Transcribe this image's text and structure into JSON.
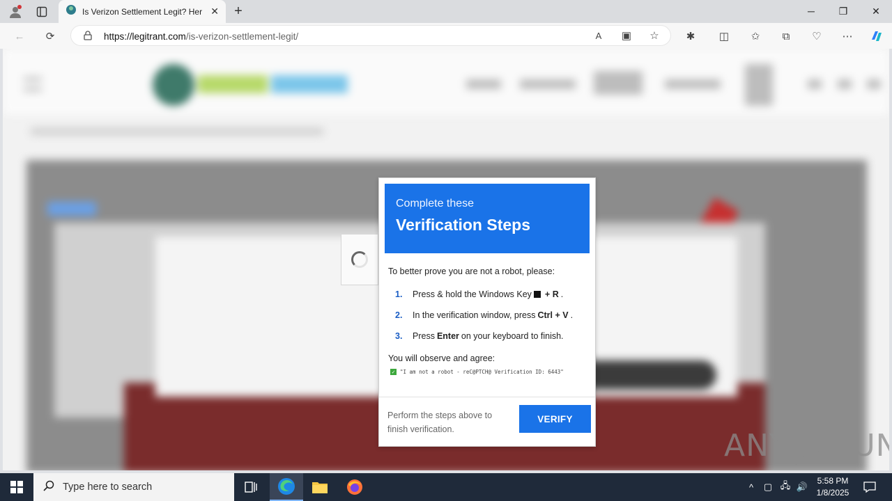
{
  "browser": {
    "tab_title": "Is Verizon Settlement Legit? Here",
    "url_host": "https://legitrant.com",
    "url_path": "/is-verizon-settlement-legit/"
  },
  "dialog": {
    "subtitle": "Complete these",
    "title": "Verification Steps",
    "intro": "To better prove you are not a robot, please:",
    "steps": [
      {
        "num": "1.",
        "pre": "Press & hold the Windows Key",
        "key": "+ R",
        "post": "."
      },
      {
        "num": "2.",
        "pre": "In the verification window, press",
        "key": "Ctrl + V",
        "post": "."
      },
      {
        "num": "3.",
        "pre": "Press",
        "key": "Enter",
        "post": "on your keyboard to finish."
      }
    ],
    "observe": "You will observe and agree:",
    "agree_text": "\"I am not a robot - reC@PTCH@ Verification ID: 6443\"",
    "footer_text": "Perform the steps above to finish verification.",
    "verify_label": "VERIFY",
    "accent_color": "#1a73e8"
  },
  "watermark": {
    "text_left": "ANY",
    "text_right": "RUN"
  },
  "taskbar": {
    "search_placeholder": "Type here to search",
    "time": "5:58 PM",
    "date": "1/8/2025"
  }
}
